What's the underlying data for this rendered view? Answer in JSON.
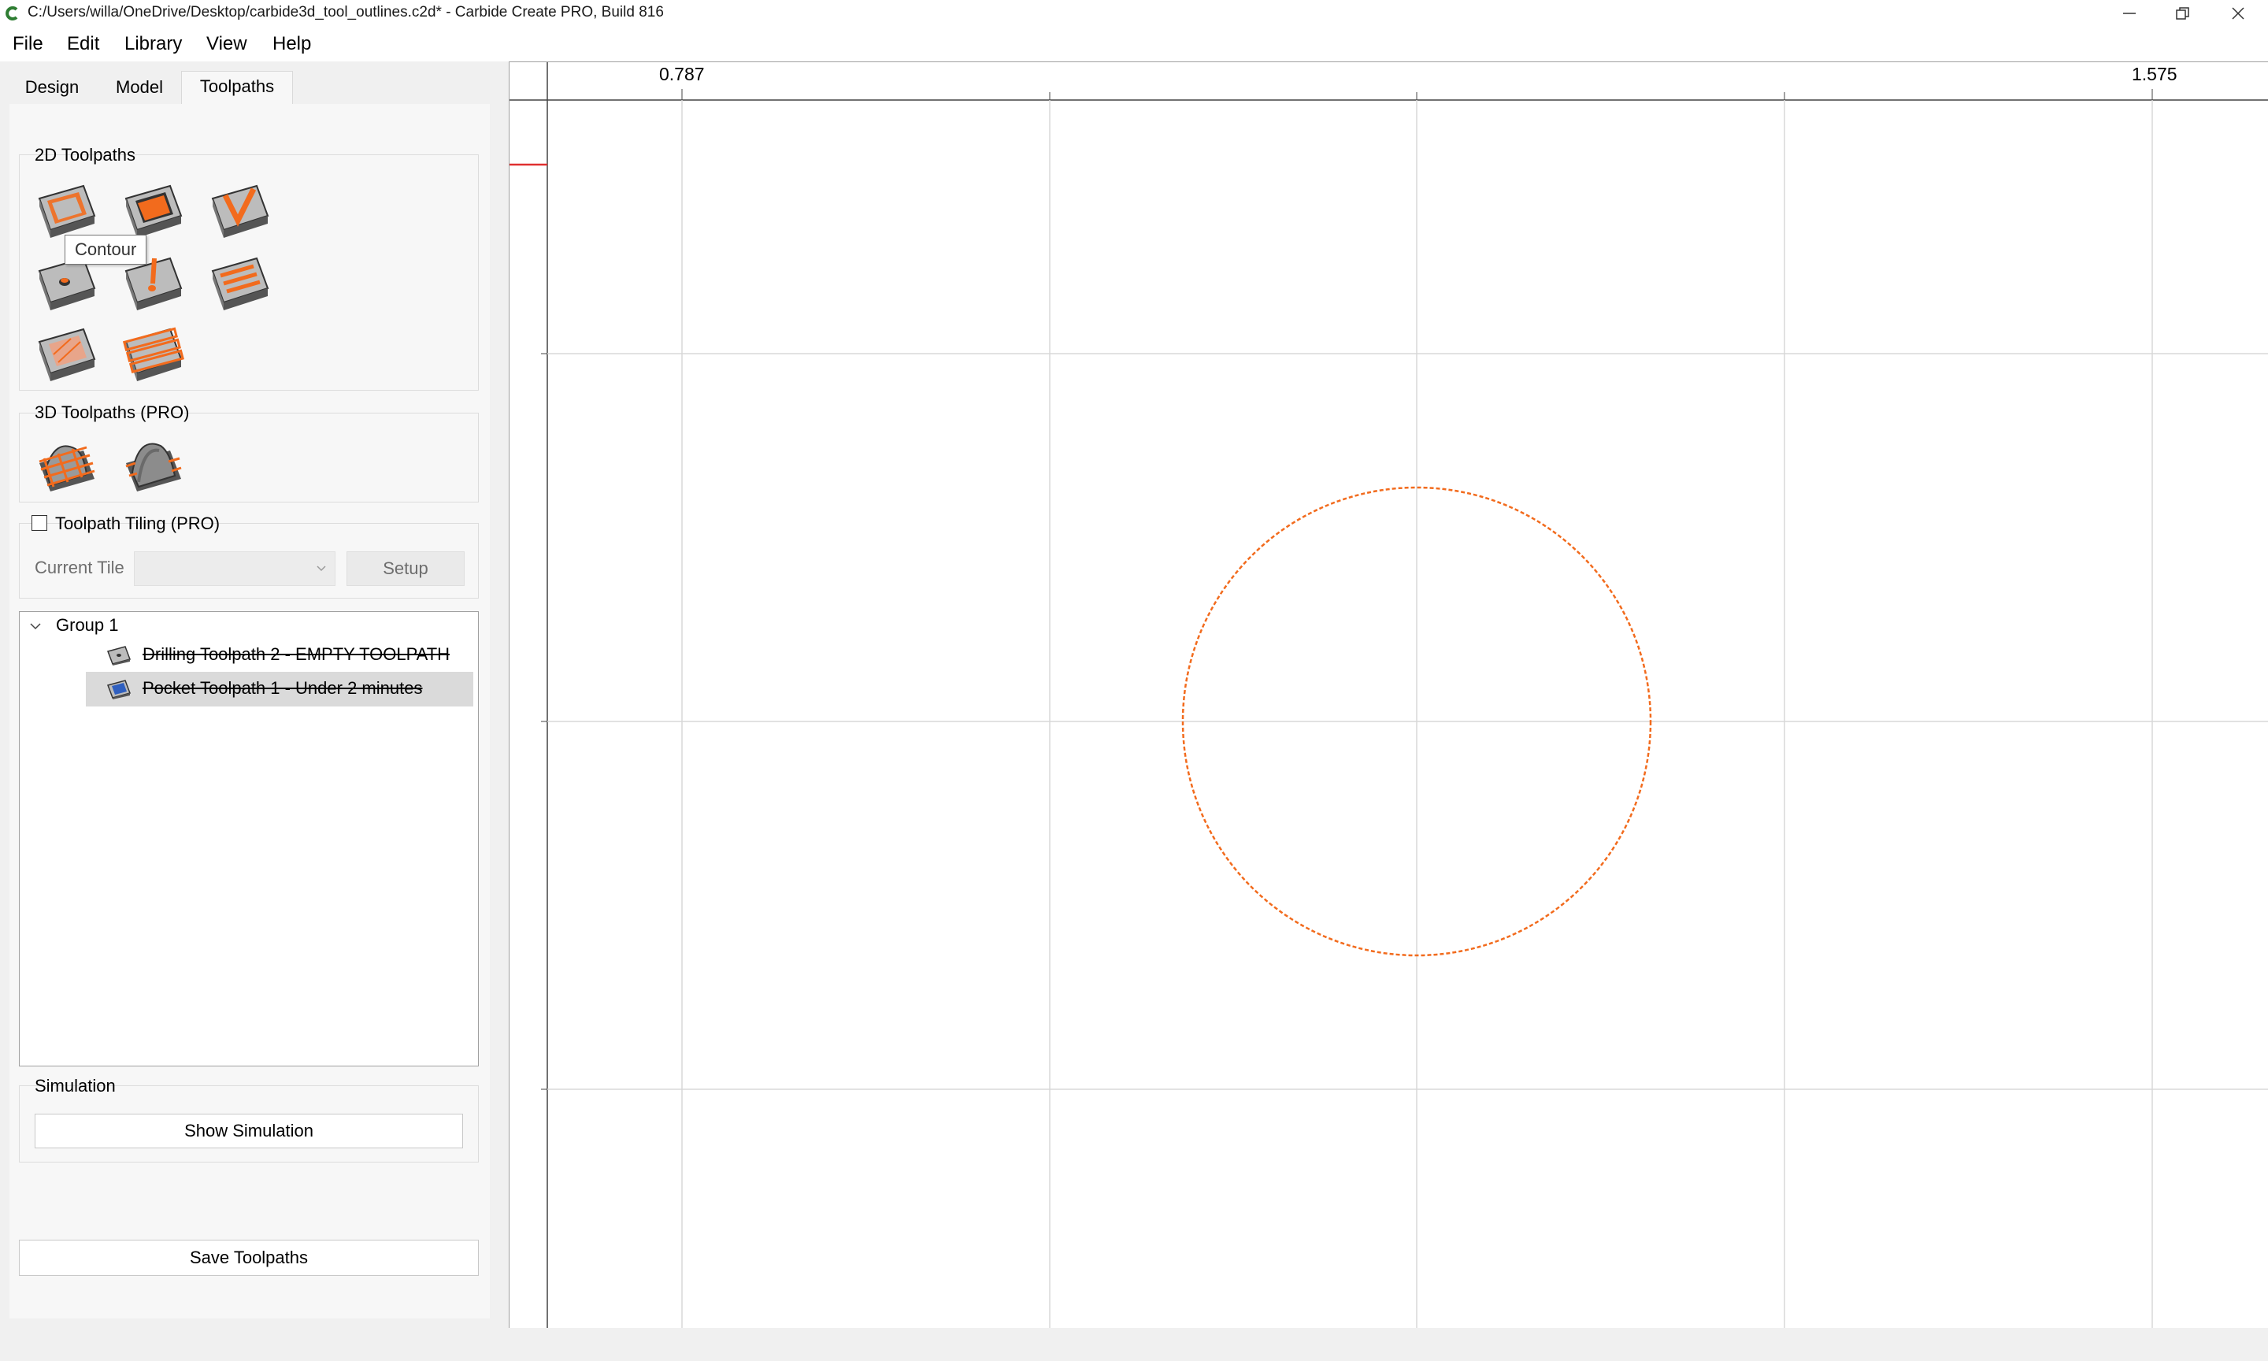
{
  "window": {
    "title": "C:/Users/willa/OneDrive/Desktop/carbide3d_tool_outlines.c2d* - Carbide Create PRO, Build 816"
  },
  "menu": {
    "items": [
      {
        "label": "File"
      },
      {
        "label": "Edit"
      },
      {
        "label": "Library"
      },
      {
        "label": "View"
      },
      {
        "label": "Help"
      }
    ]
  },
  "tabs": [
    {
      "label": "Design",
      "active": false
    },
    {
      "label": "Model",
      "active": false
    },
    {
      "label": "Toolpaths",
      "active": true
    }
  ],
  "toolpaths_2d": {
    "title": "2D Toolpaths",
    "tools": [
      {
        "name": "contour-icon"
      },
      {
        "name": "pocket-icon"
      },
      {
        "name": "vcarve-icon"
      },
      {
        "name": "drill-icon"
      },
      {
        "name": "advanced-vcarve-icon"
      },
      {
        "name": "texture-icon"
      },
      {
        "name": "rough-pocket-icon"
      },
      {
        "name": "slot-rows-icon"
      }
    ],
    "tooltip": "Contour"
  },
  "toolpaths_3d": {
    "title": "3D Toolpaths (PRO)",
    "tools": [
      {
        "name": "3d-rough-icon"
      },
      {
        "name": "3d-finish-icon"
      }
    ]
  },
  "tiling": {
    "checkbox_label": "Toolpath Tiling (PRO)",
    "checked": false,
    "current_tile_label": "Current Tile",
    "current_tile_value": "",
    "setup_label": "Setup"
  },
  "toolpath_tree": {
    "group_label": "Group 1",
    "items": [
      {
        "label": "Drilling Toolpath 2 - EMPTY TOOLPATH",
        "selected": false,
        "icon": "drill-toolpath-icon"
      },
      {
        "label": "Pocket Toolpath 1 - Under 2 minutes",
        "selected": true,
        "icon": "pocket-toolpath-icon"
      }
    ]
  },
  "simulation": {
    "title": "Simulation",
    "show_label": "Show Simulation"
  },
  "save_label": "Save Toolpaths",
  "canvas": {
    "ruler_labels": [
      "0.787",
      "1.575"
    ],
    "circle_color": "#f26b1d",
    "grid_color": "#d8d8d8"
  }
}
